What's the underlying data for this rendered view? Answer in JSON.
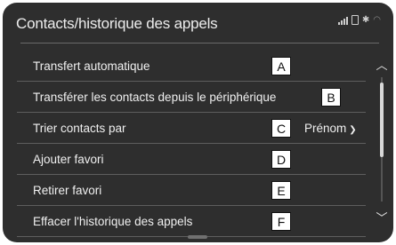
{
  "header": {
    "title": "Contacts/historique des appels"
  },
  "status_icons": [
    "signal-icon",
    "battery-icon",
    "bluetooth-icon",
    "wifi-icon"
  ],
  "items": [
    {
      "label": "Transfert automatique",
      "badge": "A"
    },
    {
      "label": "Transférer les contacts depuis le périphérique",
      "badge": "B"
    },
    {
      "label": "Trier contacts par",
      "badge": "C",
      "value": "Prénom"
    },
    {
      "label": "Ajouter favori",
      "badge": "D"
    },
    {
      "label": "Retirer favori",
      "badge": "E"
    },
    {
      "label": "Effacer l'historique des appels",
      "badge": "F"
    }
  ],
  "colors": {
    "screen_bg": "#2e2e2e",
    "text": "#f0f0f0",
    "divider": "#5e5e5e"
  }
}
